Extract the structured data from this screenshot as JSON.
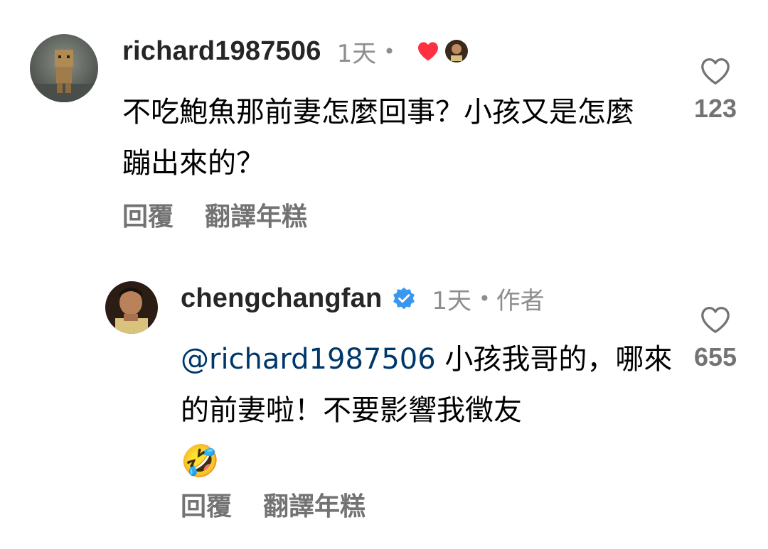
{
  "comments": [
    {
      "username": "richard1987506",
      "time": "1天",
      "separator": "•",
      "text": "不吃鮑魚那前妻怎麼回事？小孩又是怎麼蹦出來的？",
      "like_count": "123",
      "liked_by_author": true,
      "reply_label": "回覆",
      "translate_label": "翻譯年糕",
      "avatar_icon": "cardboard-robot-avatar"
    },
    {
      "username": "chengchangfan",
      "verified": true,
      "time": "1天",
      "separator": "•",
      "author_tag": "作者",
      "mention": "@richard1987506",
      "text": " 小孩我哥的，哪來的前妻啦！不要影響我徵友",
      "emoji": "🤣",
      "like_count": "655",
      "reply_label": "回覆",
      "translate_label": "翻譯年糕",
      "avatar_icon": "profile-photo-avatar"
    }
  ],
  "colors": {
    "heart_red": "#ff3040",
    "verified_blue": "#3897f0",
    "mention_blue": "#00376b",
    "meta_gray": "#8e8e8e"
  }
}
